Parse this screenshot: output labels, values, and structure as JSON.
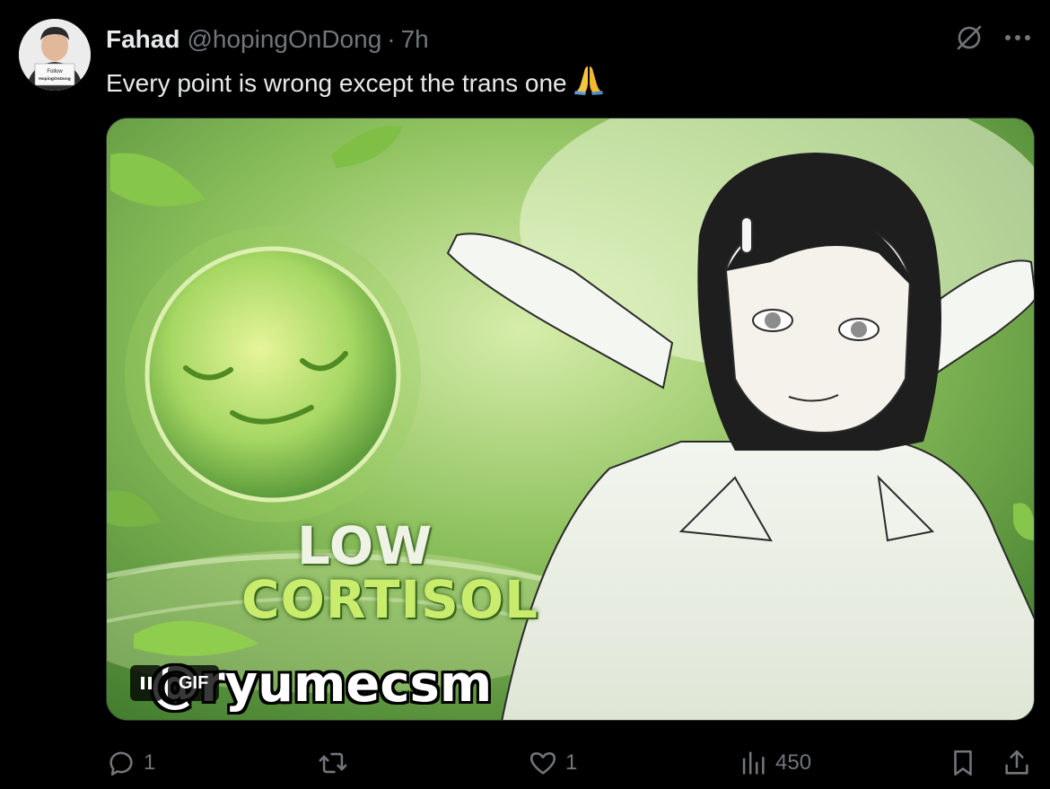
{
  "tweet": {
    "author_name": "Fahad",
    "handle": "@hopingOnDong",
    "separator": "·",
    "time": "7h",
    "text": "Every point is wrong except the trans one",
    "emoji": "🙏"
  },
  "avatar": {
    "sign_line1": "Follow",
    "sign_line2": "HopingOnDong"
  },
  "media": {
    "caption_line1": "LOW",
    "caption_line2": "CORTISOL",
    "watermark": "@ryumecsm",
    "gif_label": "GIF"
  },
  "actions": {
    "replies": "1",
    "reposts": "",
    "likes": "1",
    "views": "450"
  },
  "icons": {
    "grok": "grok-slash-icon",
    "more": "more-icon",
    "reply": "reply-icon",
    "repost": "repost-icon",
    "like": "heart-icon",
    "views": "views-bar-icon",
    "bookmark": "bookmark-icon",
    "share": "share-icon"
  },
  "colors": {
    "background": "#000000",
    "primary_text": "#e7e9ea",
    "secondary_text": "#71767b",
    "border": "#2f3336"
  }
}
